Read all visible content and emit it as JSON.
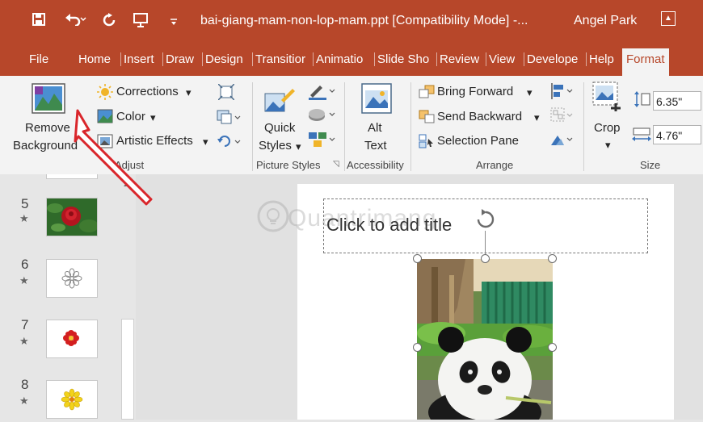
{
  "titlebar": {
    "doc_title": "bai-giang-mam-non-lop-mam.ppt [Compatibility Mode]  -...",
    "user": "Angel Park",
    "bg_color": "#b7472a"
  },
  "tabs": [
    {
      "label": "File"
    },
    {
      "label": "Home"
    },
    {
      "label": "Insert"
    },
    {
      "label": "Draw"
    },
    {
      "label": "Design"
    },
    {
      "label": "Transitior"
    },
    {
      "label": "Animatio"
    },
    {
      "label": "Slide Sho"
    },
    {
      "label": "Review"
    },
    {
      "label": "View"
    },
    {
      "label": "Develope"
    },
    {
      "label": "Help"
    },
    {
      "label": "Format"
    }
  ],
  "ribbon": {
    "adjust": {
      "remove_bg_line1": "Remove",
      "remove_bg_line2": "Background",
      "corrections": "Corrections",
      "color": "Color",
      "artistic_effects": "Artistic Effects",
      "group_name": "Adjust"
    },
    "picture_styles": {
      "quick_styles_line1": "Quick",
      "quick_styles_line2": "Styles",
      "group_name": "Picture Styles"
    },
    "accessibility": {
      "alt_text_line1": "Alt",
      "alt_text_line2": "Text",
      "group_name": "Accessibility"
    },
    "arrange": {
      "bring_forward": "Bring Forward",
      "send_backward": "Send Backward",
      "selection_pane": "Selection Pane",
      "group_name": "Arrange"
    },
    "size": {
      "crop": "Crop",
      "height": "6.35\"",
      "width": "4.76\"",
      "group_name": "Size"
    }
  },
  "thumbnails": [
    {
      "number": "5",
      "content": "rose-photo"
    },
    {
      "number": "6",
      "content": "flower-outline"
    },
    {
      "number": "7",
      "content": "red-flower"
    },
    {
      "number": "8",
      "content": "yellow-flower"
    }
  ],
  "slide": {
    "title_placeholder": "Click to add title",
    "watermark": "Quantrimang"
  },
  "colors": {
    "accent": "#b7472a",
    "annotation_arrow": "#d9262b"
  }
}
